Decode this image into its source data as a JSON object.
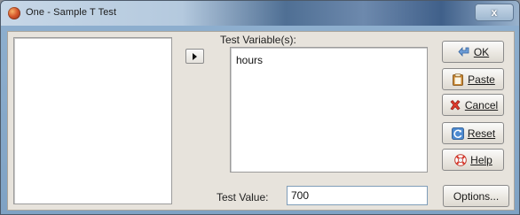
{
  "window": {
    "title": "One - Sample T Test",
    "close_glyph": "x"
  },
  "variable_list": {
    "items": []
  },
  "test_variables": {
    "label": "Test Variable(s):",
    "items": [
      "hours"
    ]
  },
  "test_value": {
    "label": "Test Value:",
    "value": "700"
  },
  "buttons": {
    "ok": {
      "label": "OK",
      "icon": "ok-arrow-icon"
    },
    "paste": {
      "label": "Paste",
      "icon": "clipboard-icon"
    },
    "cancel": {
      "label": "Cancel",
      "icon": "red-x-icon"
    },
    "reset": {
      "label": "Reset",
      "icon": "reset-icon"
    },
    "help": {
      "label": "Help",
      "icon": "lifebuoy-icon"
    },
    "options": {
      "label": "Options..."
    }
  },
  "colors": {
    "dialog_bg": "#e7e3dc",
    "titlebar_dark": "#40608a",
    "input_border": "#7f9db9"
  }
}
